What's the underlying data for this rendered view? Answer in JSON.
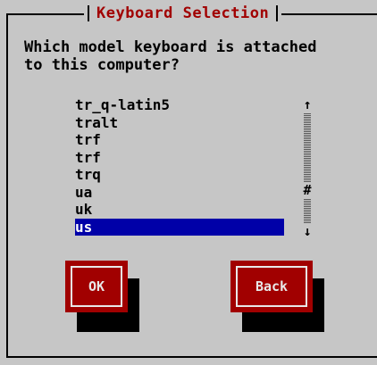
{
  "dialog": {
    "title": "Keyboard Selection",
    "prompt": "Which model keyboard is attached\nto this computer?"
  },
  "keyboard_list": {
    "items": [
      "tr_q-latin5",
      "tralt",
      "trf",
      "trf",
      "trq",
      "ua",
      "uk",
      "us"
    ],
    "selected_index": 7
  },
  "scrollbar": {
    "up_glyph": "↑",
    "down_glyph": "↓",
    "thumb_glyph": "#"
  },
  "buttons": {
    "ok_label": "OK",
    "back_label": "Back"
  },
  "colors": {
    "background": "#c6c6c6",
    "title": "#a10000",
    "selection": "#0000a8",
    "button": "#a10000"
  }
}
